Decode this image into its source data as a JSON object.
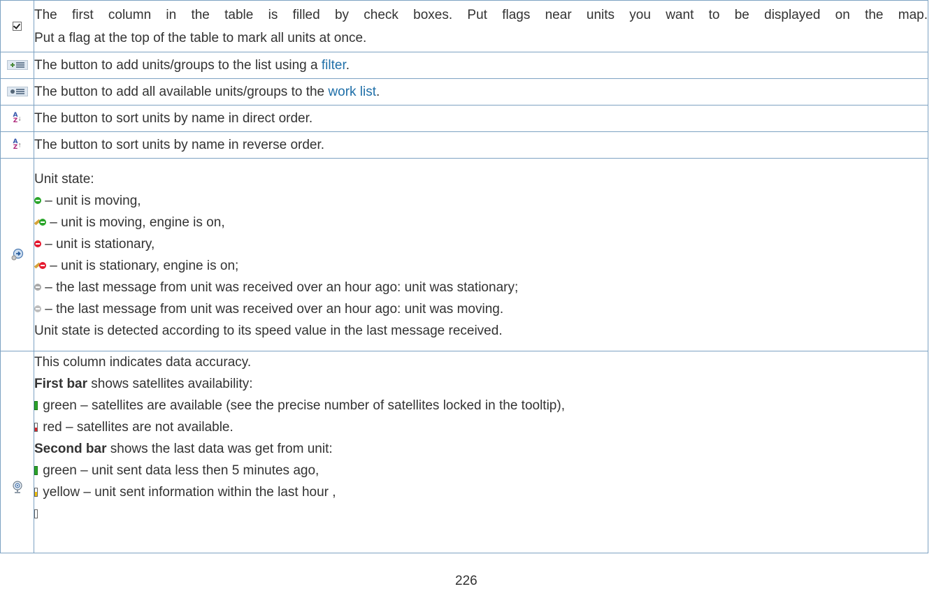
{
  "rows": {
    "checkboxes": {
      "icon": "checkbox-checked-icon",
      "line1": "The first column in the table is filled by check boxes. Put flags near units you want to be displayed on the map.",
      "line2": "Put a flag at the top of the table to mark all units at once."
    },
    "filter": {
      "icon": "add-by-filter-icon",
      "text_before": "The button to add units/groups to the list using a",
      "link": "filter",
      "text_after": "."
    },
    "add_all": {
      "icon": "add-all-icon",
      "text_before": "The button to add all available units/groups to the",
      "link": "work list",
      "text_after": "."
    },
    "sort_direct": {
      "icon": "sort-az-icon",
      "text": "The button to sort units by name in direct order."
    },
    "sort_reverse": {
      "icon": "sort-za-icon",
      "text": "The button to sort units by name in reverse order."
    },
    "unit_state": {
      "icon": "unit-state-icon",
      "heading": "Unit state:",
      "items": [
        {
          "icon": "moving-icon",
          "text": "– unit is moving,"
        },
        {
          "icon": "moving-engine-on-icon",
          "text": "– unit is moving, engine is on,"
        },
        {
          "icon": "stationary-icon",
          "text": "– unit is stationary,"
        },
        {
          "icon": "stationary-engine-on-icon",
          "text": "– unit is stationary, engine is on;"
        },
        {
          "icon": "old-message-stationary-icon",
          "text": "– the last message from unit was received over an hour ago: unit was stationary;"
        },
        {
          "icon": "old-message-moving-icon",
          "text": "– the last message from unit was received over an hour ago: unit was moving."
        }
      ],
      "note": "Unit state is detected according to its speed value in the last message received."
    },
    "accuracy": {
      "icon": "satellite-dish-icon",
      "heading": "This column indicates data accuracy.",
      "first_bar_bold": "First bar",
      "first_bar_rest": " shows satellites availability:",
      "first_items": [
        {
          "icon": "green-bar-icon",
          "text": "green – satellites are available (see the precise number of satellites locked in the tooltip),"
        },
        {
          "icon": "red-bar-icon",
          "text": "red – satellites are not available."
        }
      ],
      "second_bar_bold": "Second bar",
      "second_bar_rest": " shows the last data was get from unit:",
      "second_items": [
        {
          "icon": "green-bar-icon",
          "text": "green – unit sent data less then 5 minutes ago,"
        },
        {
          "icon": "yellow-bar-icon",
          "text": "yellow – unit sent information within the last hour ,"
        }
      ]
    }
  },
  "page_number": "226"
}
